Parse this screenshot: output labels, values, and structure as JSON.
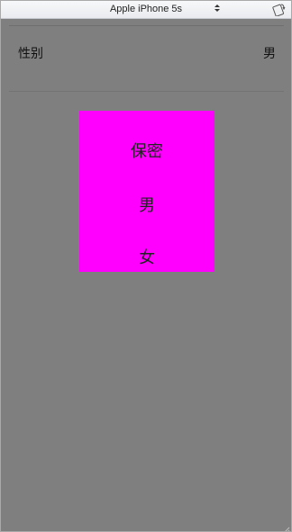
{
  "device_bar": {
    "device_name": "Apple iPhone 5s",
    "arrows": "▲▼",
    "rotate_icon": "rotate-device-icon"
  },
  "form": {
    "gender_label": "性别",
    "gender_value": "男"
  },
  "picker": {
    "background": "#ff00ff",
    "options": [
      "保密",
      "男",
      "女"
    ]
  },
  "colors": {
    "screen_background": "#7f7f7f"
  }
}
